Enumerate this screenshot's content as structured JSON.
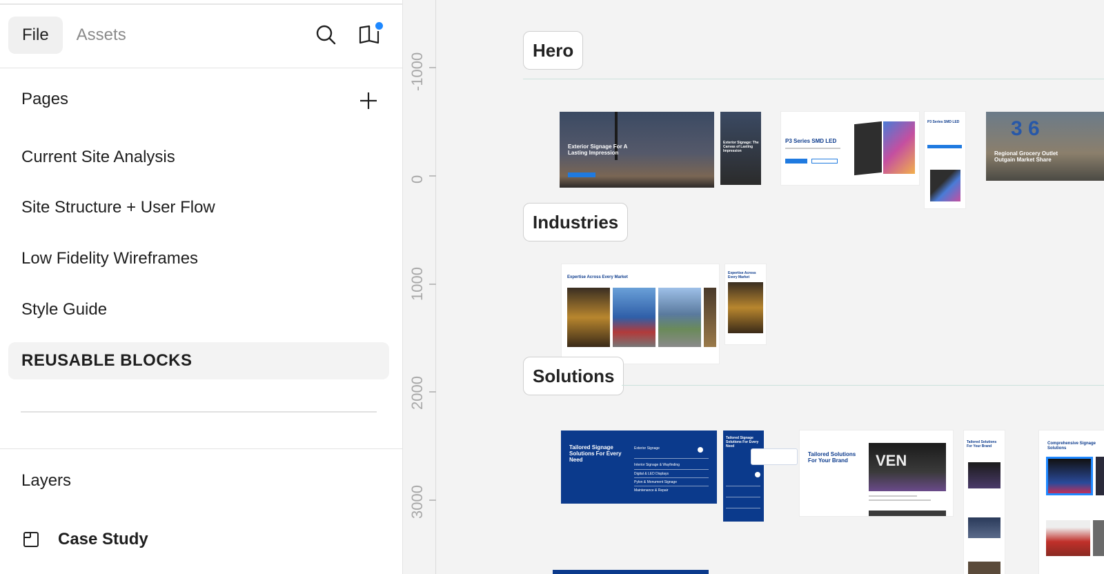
{
  "panel": {
    "tabs": [
      {
        "label": "File",
        "active": true
      },
      {
        "label": "Assets",
        "active": false
      }
    ],
    "icons": {
      "search": "search-icon",
      "library": "book-icon",
      "add": "plus-icon",
      "layer": "frame-icon"
    },
    "notification_color": "#1e88ff",
    "pages_title": "Pages",
    "pages": [
      {
        "label": "Current Site Analysis"
      },
      {
        "label": "Site Structure + User Flow"
      },
      {
        "label": "Low Fidelity Wireframes"
      },
      {
        "label": "Style Guide"
      },
      {
        "label": "REUSABLE BLOCKS",
        "active": true
      }
    ],
    "layers_title": "Layers",
    "layers": [
      {
        "label": "Case Study"
      }
    ]
  },
  "ruler": {
    "labels": [
      "-1000",
      "0",
      "1000",
      "2000",
      "3000"
    ]
  },
  "canvas": {
    "sections": [
      {
        "label": "Hero"
      },
      {
        "label": "Industries"
      },
      {
        "label": "Solutions"
      }
    ],
    "frames": {
      "hero1_title": "Exterior Signage For A Lasting Impression",
      "hero2_title": "Exterior Signage: The Canvas of Lasting Impression",
      "hero3_title": "P3 Series SMD LED",
      "hero4_title": "P3 Series SMD LED",
      "hero5_title": "Regional Grocery Outlet Outgain Market Share",
      "hero5_logo": "3 6",
      "ind1_title": "Expertise Across Every Market",
      "ind2_title": "Expertise Across Every Market",
      "sol1_title": "Tailored Signage Solutions For Every Need",
      "sol1_items": [
        "Exterior Signage",
        "Interior Signage & Wayfinding",
        "Digital & LED Displays",
        "Pylon & Monument Signage",
        "Maintenance & Repair"
      ],
      "sol2_title": "Tailored Signage Solutions For Every Need",
      "sol3_title": "Tailored Solutions For Your Brand",
      "sol3_logo": "VEN",
      "sol4_title": "Tailored Solutions For Your Brand",
      "sol5_title": "Comprehensive Signage Solutions"
    }
  }
}
